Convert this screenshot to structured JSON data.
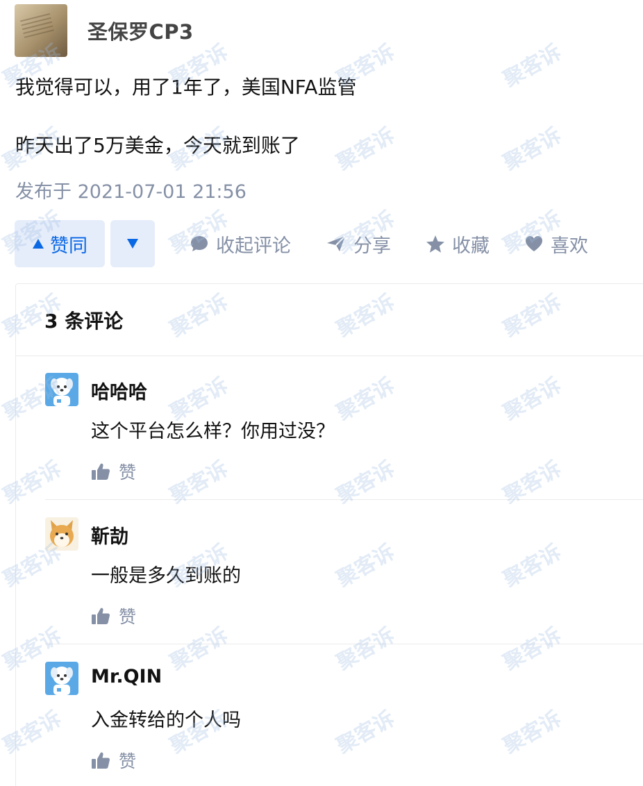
{
  "post": {
    "author_name": "圣保罗CP3",
    "body_lines": [
      "我觉得可以，用了1年了，美国NFA监管",
      "昨天出了5万美金，今天就到账了"
    ],
    "publish_time": "发布于 2021-07-01 21:56"
  },
  "actions": {
    "vote_up_label": "赞同",
    "collapse_comments_label": "收起评论",
    "share_label": "分享",
    "favorite_label": "收藏",
    "like_label": "喜欢"
  },
  "comments": {
    "header": "3 条评论",
    "items": [
      {
        "author": "哈哈哈",
        "text": "这个平台怎么样？你用过没？",
        "like_label": "赞",
        "avatar_icon": "puppy-avatar"
      },
      {
        "author": "靳劼",
        "text": "一般是多久到账的",
        "like_label": "赞",
        "avatar_icon": "shiba-dog-avatar"
      },
      {
        "author": "Mr.QIN",
        "text": "入金转给的个人吗",
        "like_label": "赞",
        "avatar_icon": "puppy-avatar"
      }
    ]
  },
  "watermark": {
    "text": "聚客诉"
  },
  "colors": {
    "accent": "#0b68e5",
    "accent_bg": "#e5edfb",
    "muted": "#8590a6",
    "text": "#121212"
  }
}
